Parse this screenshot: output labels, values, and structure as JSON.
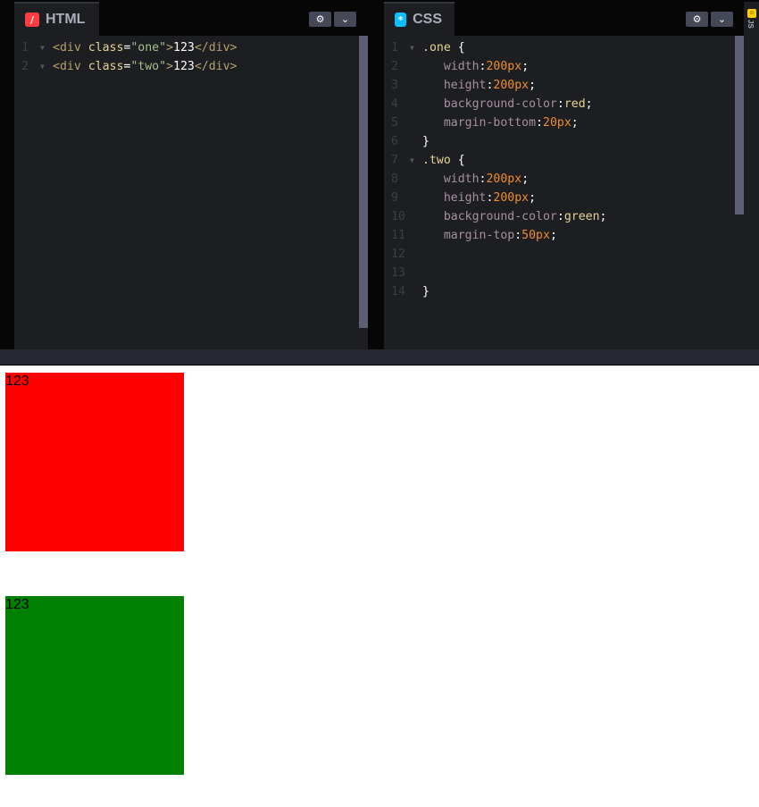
{
  "html_panel": {
    "tab_label": "HTML",
    "badge_glyph": "/",
    "settings_icon": "gear-icon",
    "collapse_icon": "chevron-down-icon",
    "lines": [
      {
        "num": "1",
        "tokens": [
          {
            "t": "<div ",
            "c": "tag"
          },
          {
            "t": "class",
            "c": "attr"
          },
          {
            "t": "=",
            "c": "punc"
          },
          {
            "t": "\"one\"",
            "c": "str"
          },
          {
            "t": ">",
            "c": "tag"
          },
          {
            "t": "123",
            "c": "txt"
          },
          {
            "t": "</div>",
            "c": "tag"
          }
        ]
      },
      {
        "num": "2",
        "tokens": [
          {
            "t": "<div ",
            "c": "tag"
          },
          {
            "t": "class",
            "c": "attr"
          },
          {
            "t": "=",
            "c": "punc"
          },
          {
            "t": "\"two\"",
            "c": "str"
          },
          {
            "t": ">",
            "c": "tag"
          },
          {
            "t": "123",
            "c": "txt"
          },
          {
            "t": "</div>",
            "c": "tag"
          }
        ]
      }
    ]
  },
  "css_panel": {
    "tab_label": "CSS",
    "badge_glyph": "*",
    "settings_icon": "gear-icon",
    "collapse_icon": "chevron-down-icon",
    "lines": [
      {
        "num": "1",
        "fold": true,
        "tokens": [
          {
            "t": ".one",
            "c": "sel"
          },
          {
            "t": " {",
            "c": "punc"
          }
        ]
      },
      {
        "num": "2",
        "tokens": [
          {
            "t": "   width",
            "c": "prop"
          },
          {
            "t": ":",
            "c": "punc"
          },
          {
            "t": "200px",
            "c": "val"
          },
          {
            "t": ";",
            "c": "punc"
          }
        ]
      },
      {
        "num": "3",
        "tokens": [
          {
            "t": "   height",
            "c": "prop"
          },
          {
            "t": ":",
            "c": "punc"
          },
          {
            "t": "200px",
            "c": "val"
          },
          {
            "t": ";",
            "c": "punc"
          }
        ]
      },
      {
        "num": "4",
        "tokens": [
          {
            "t": "   background-color",
            "c": "prop"
          },
          {
            "t": ":",
            "c": "punc"
          },
          {
            "t": "red",
            "c": "kw"
          },
          {
            "t": ";",
            "c": "punc"
          }
        ]
      },
      {
        "num": "5",
        "tokens": [
          {
            "t": "   margin-bottom",
            "c": "prop"
          },
          {
            "t": ":",
            "c": "punc"
          },
          {
            "t": "20px",
            "c": "val"
          },
          {
            "t": ";",
            "c": "punc"
          }
        ]
      },
      {
        "num": "6",
        "tokens": [
          {
            "t": "}",
            "c": "punc"
          }
        ]
      },
      {
        "num": "7",
        "fold": true,
        "tokens": [
          {
            "t": ".two",
            "c": "sel"
          },
          {
            "t": " {",
            "c": "punc"
          }
        ]
      },
      {
        "num": "8",
        "tokens": [
          {
            "t": "   width",
            "c": "prop"
          },
          {
            "t": ":",
            "c": "punc"
          },
          {
            "t": "200px",
            "c": "val"
          },
          {
            "t": ";",
            "c": "punc"
          }
        ]
      },
      {
        "num": "9",
        "tokens": [
          {
            "t": "   height",
            "c": "prop"
          },
          {
            "t": ":",
            "c": "punc"
          },
          {
            "t": "200px",
            "c": "val"
          },
          {
            "t": ";",
            "c": "punc"
          }
        ]
      },
      {
        "num": "10",
        "tokens": [
          {
            "t": "   background-color",
            "c": "prop"
          },
          {
            "t": ":",
            "c": "punc"
          },
          {
            "t": "green",
            "c": "kw"
          },
          {
            "t": ";",
            "c": "punc"
          }
        ]
      },
      {
        "num": "11",
        "tokens": [
          {
            "t": "   margin-top",
            "c": "prop"
          },
          {
            "t": ":",
            "c": "punc"
          },
          {
            "t": "50px",
            "c": "val"
          },
          {
            "t": ";",
            "c": "punc"
          }
        ]
      },
      {
        "num": "12",
        "tokens": []
      },
      {
        "num": "13",
        "tokens": []
      },
      {
        "num": "14",
        "tokens": [
          {
            "t": "}",
            "c": "punc"
          }
        ]
      }
    ]
  },
  "js_panel": {
    "label": "JS",
    "badge_glyph": "☺"
  },
  "preview": {
    "box_one_text": "123",
    "box_two_text": "123",
    "box_one_color": "#ff0000",
    "box_two_color": "#008000"
  },
  "colors": {
    "editor_bg": "#1d1e22",
    "chrome_bg": "#060606",
    "html_badge": "#ff3c41",
    "css_badge": "#0ebeff",
    "js_badge": "#fcd000"
  }
}
